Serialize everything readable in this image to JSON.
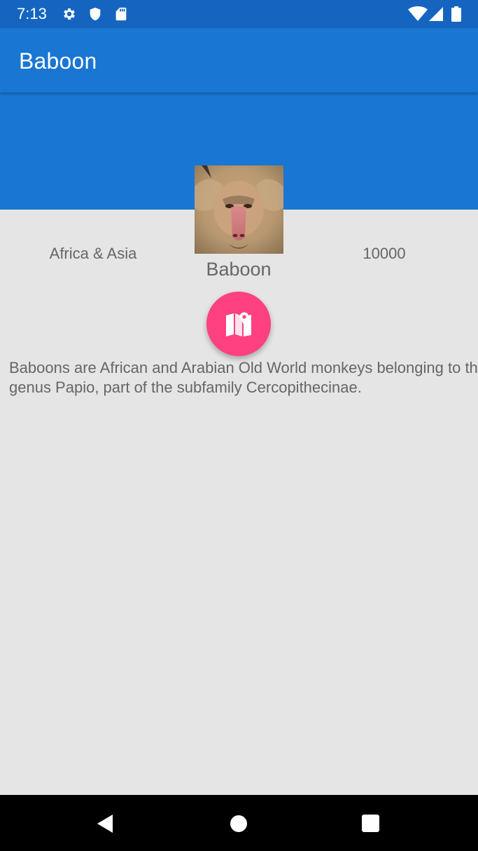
{
  "status_bar": {
    "time": "7:13",
    "icons": [
      "settings-gear-icon",
      "shield-icon",
      "sd-card-icon",
      "wifi-icon",
      "cellular-signal-icon",
      "battery-icon"
    ]
  },
  "app_bar": {
    "title": "Baboon"
  },
  "animal": {
    "photo_icon": "baboon-photo",
    "name": "Baboon",
    "location": "Africa & Asia",
    "population": "10000",
    "description": "Baboons are African and Arabian Old World monkeys belonging to the genus Papio, part of the subfamily Cercopithecinae."
  },
  "fab": {
    "icon": "map-icon",
    "color": "#ff4081"
  },
  "nav_bar": {
    "buttons": [
      "back-triangle-icon",
      "home-circle-icon",
      "recents-square-icon"
    ]
  },
  "colors": {
    "primary": "#1976d2",
    "primary_dark": "#1565c0",
    "accent": "#ff4081",
    "background": "#e5e5e5",
    "text_secondary": "#666666"
  }
}
